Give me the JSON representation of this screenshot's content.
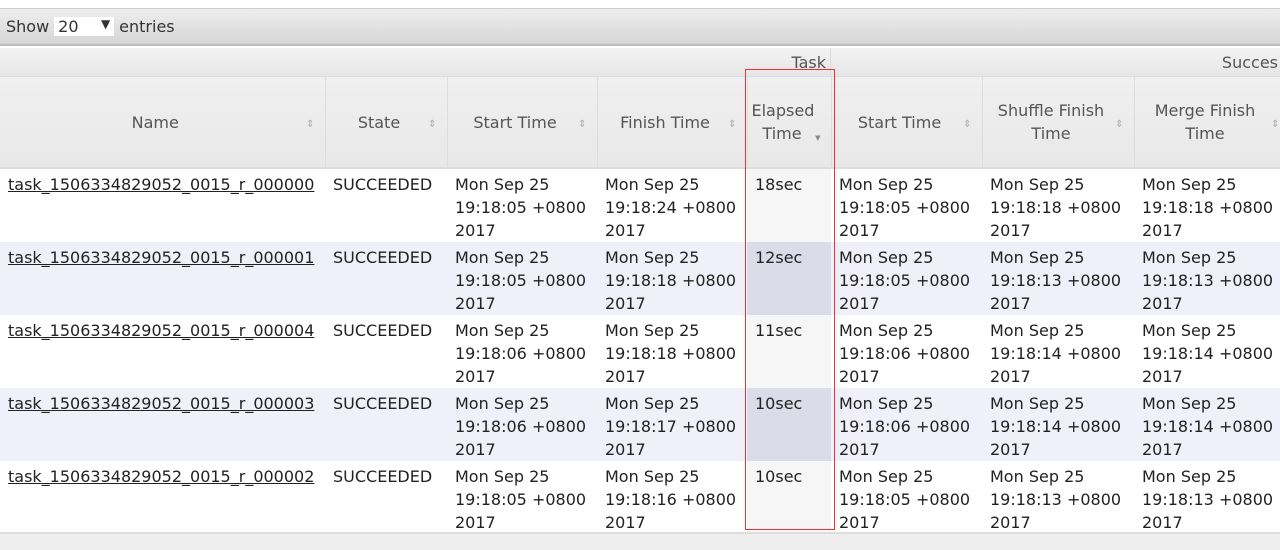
{
  "toolbar": {
    "show": "Show",
    "entries_value": "20",
    "entries": "entries"
  },
  "groups": {
    "task": "Task",
    "successful": "Succes"
  },
  "headers": [
    "Name",
    "State",
    "Start Time",
    "Finish Time",
    "Elapsed Time",
    "Start Time",
    "Shuffle Finish Time",
    "Merge Finish Time"
  ],
  "rows": [
    {
      "name": "task_1506334829052_0015_r_000000",
      "state": "SUCCEEDED",
      "start": "Mon Sep 25 19:18:05 +0800 2017",
      "finish": "Mon Sep 25 19:18:24 +0800 2017",
      "elapsed": "18sec",
      "s_start": "Mon Sep 25 19:18:05 +0800 2017",
      "shuffle": "Mon Sep 25 19:18:18 +0800 2017",
      "merge": "Mon Sep 25 19:18:18 +0800 2017"
    },
    {
      "name": "task_1506334829052_0015_r_000001",
      "state": "SUCCEEDED",
      "start": "Mon Sep 25 19:18:05 +0800 2017",
      "finish": "Mon Sep 25 19:18:18 +0800 2017",
      "elapsed": "12sec",
      "s_start": "Mon Sep 25 19:18:05 +0800 2017",
      "shuffle": "Mon Sep 25 19:18:13 +0800 2017",
      "merge": "Mon Sep 25 19:18:13 +0800 2017"
    },
    {
      "name": "task_1506334829052_0015_r_000004",
      "state": "SUCCEEDED",
      "start": "Mon Sep 25 19:18:06 +0800 2017",
      "finish": "Mon Sep 25 19:18:18 +0800 2017",
      "elapsed": "11sec",
      "s_start": "Mon Sep 25 19:18:06 +0800 2017",
      "shuffle": "Mon Sep 25 19:18:14 +0800 2017",
      "merge": "Mon Sep 25 19:18:14 +0800 2017"
    },
    {
      "name": "task_1506334829052_0015_r_000003",
      "state": "SUCCEEDED",
      "start": "Mon Sep 25 19:18:06 +0800 2017",
      "finish": "Mon Sep 25 19:18:17 +0800 2017",
      "elapsed": "10sec",
      "s_start": "Mon Sep 25 19:18:06 +0800 2017",
      "shuffle": "Mon Sep 25 19:18:14 +0800 2017",
      "merge": "Mon Sep 25 19:18:14 +0800 2017"
    },
    {
      "name": "task_1506334829052_0015_r_000002",
      "state": "SUCCEEDED",
      "start": "Mon Sep 25 19:18:05 +0800 2017",
      "finish": "Mon Sep 25 19:18:16 +0800 2017",
      "elapsed": "10sec",
      "s_start": "Mon Sep 25 19:18:05 +0800 2017",
      "shuffle": "Mon Sep 25 19:18:13 +0800 2017",
      "merge": "Mon Sep 25 19:18:13 +0800 2017"
    }
  ],
  "highlight_color": "#e33333"
}
